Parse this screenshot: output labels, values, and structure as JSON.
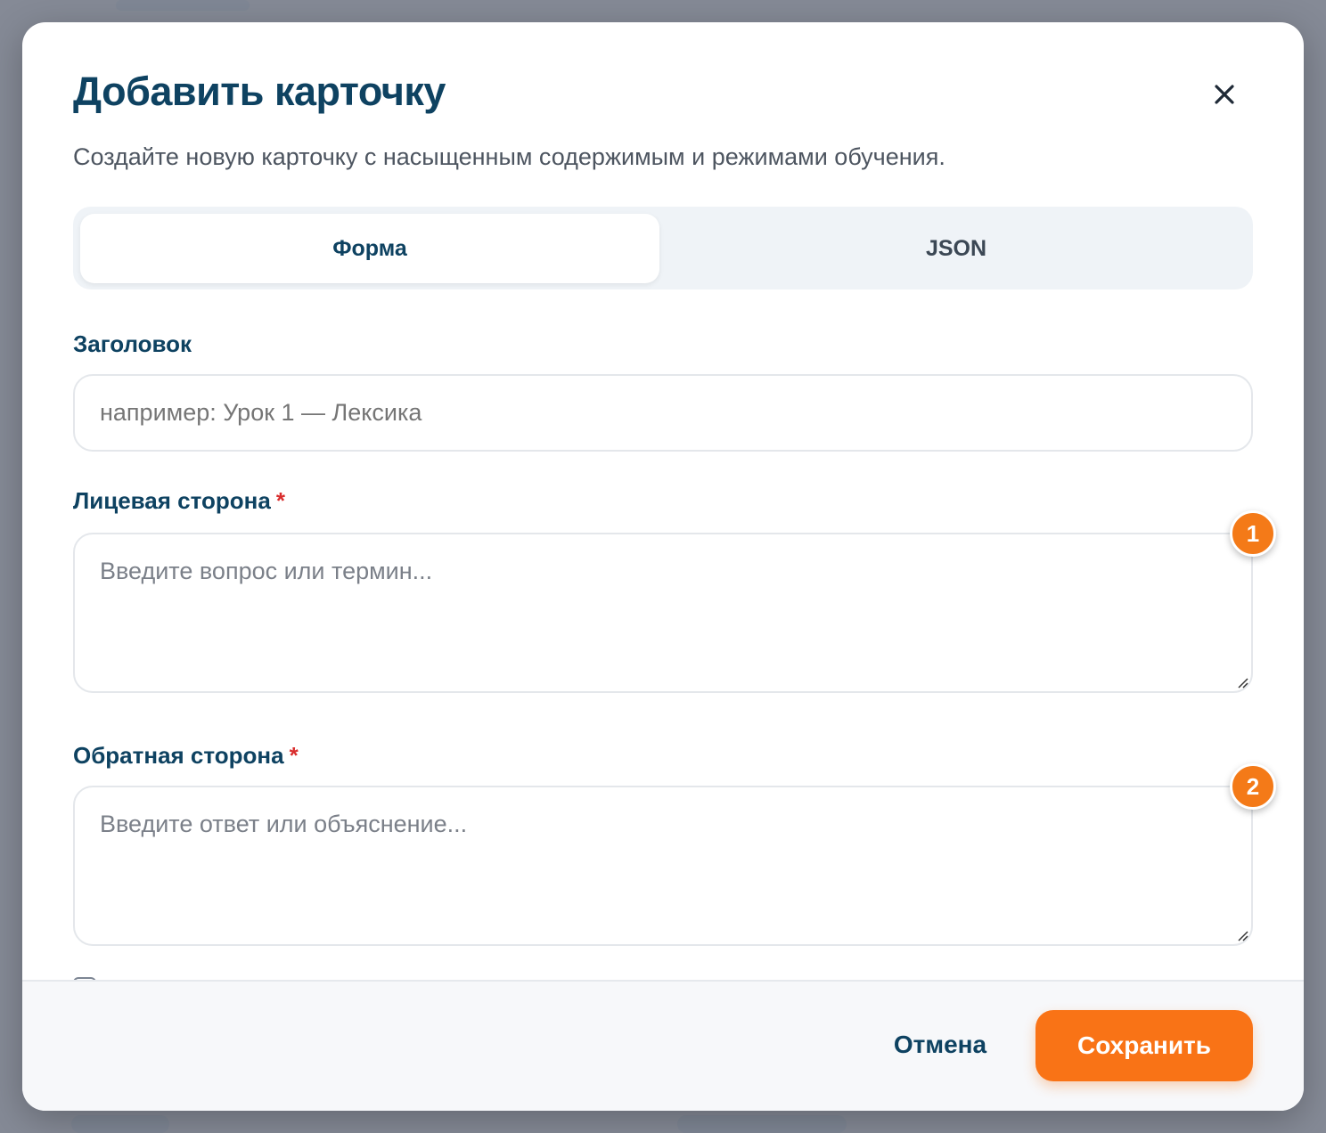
{
  "dialog": {
    "title": "Добавить карточку",
    "subtitle": "Создайте новую карточку с насыщенным содержимым и режимами обучения.",
    "close_icon": "close-icon"
  },
  "tabs": [
    {
      "label": "Форма",
      "active": true
    },
    {
      "label": "JSON",
      "active": false
    }
  ],
  "fields": {
    "title": {
      "label": "Заголовок",
      "placeholder": "например: Урок 1 — Лексика",
      "value": ""
    },
    "front": {
      "label": "Лицевая сторона",
      "required_mark": "*",
      "placeholder": "Введите вопрос или термин...",
      "value": "",
      "badge": "1"
    },
    "back": {
      "label": "Обратная сторона",
      "required_mark": "*",
      "placeholder": "Введите ответ или объяснение...",
      "value": "",
      "badge": "2"
    }
  },
  "footer": {
    "cancel_label": "Отмена",
    "save_label": "Сохранить"
  },
  "colors": {
    "accent": "#f97316",
    "heading": "#0e4261",
    "required": "#d92d2d",
    "backdrop": "#858a96"
  }
}
